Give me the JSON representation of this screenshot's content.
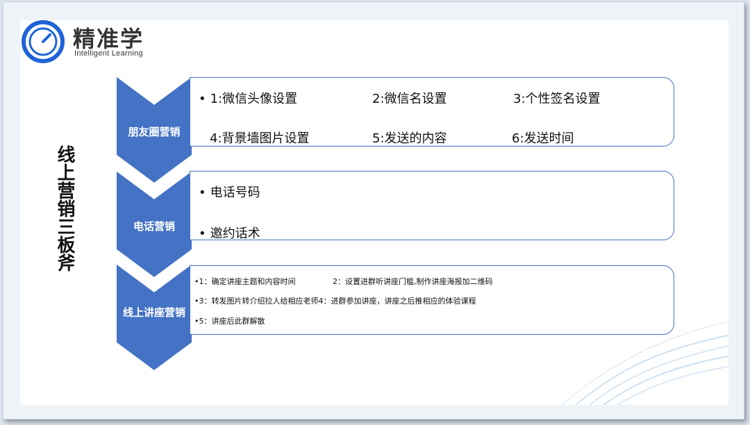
{
  "logo": {
    "cn": "精准学",
    "en": "Intelligent Learning"
  },
  "title": "线上营销三板斧",
  "sections": [
    {
      "label": "朋友圈营销",
      "items": [
        "1:微信头像设置",
        "2:微信名设置",
        "3:个性签名设置",
        "4:背景墙图片设置",
        "5:发送的内容",
        "6:发送时间"
      ]
    },
    {
      "label": "电话营销",
      "items": [
        "电话号码",
        "邀约话术"
      ]
    },
    {
      "label": "线上讲座营销",
      "items": [
        "•1：确定讲座主题和内容时间",
        "2：设置进群听讲座门槛,制作讲座海报加二维码",
        "•3：转发图片转介绍拉人给相应老师4：进群参加讲座，讲座之后推相应的体验课程",
        "•5：讲座后此群解散"
      ]
    }
  ],
  "colors": {
    "accent": "#4472c4",
    "logo_blue": "#1f63d6"
  }
}
